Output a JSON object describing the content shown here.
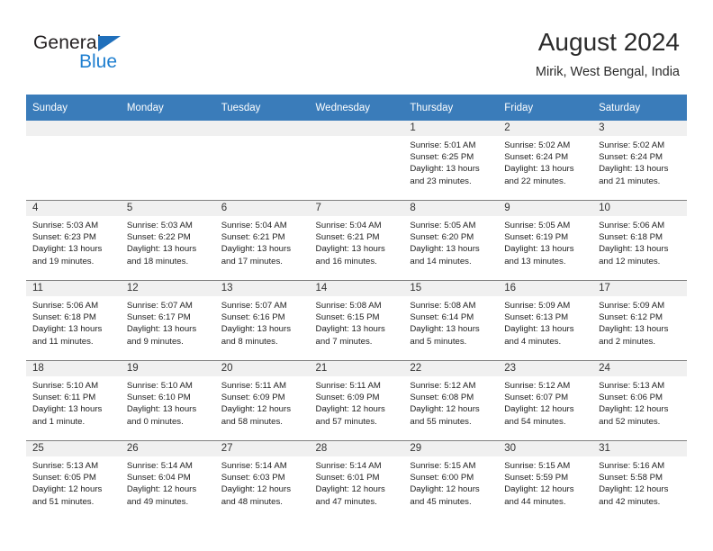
{
  "logo": {
    "word1": "General",
    "word2": "Blue",
    "triangle_color": "#1f6fbb",
    "word2_color": "#1f7fd0"
  },
  "header": {
    "title": "August 2024",
    "subtitle": "Mirik, West Bengal, India"
  },
  "theme": {
    "header_bg": "#3a7cba",
    "header_text": "#ffffff",
    "daynum_bg": "#f0f0f0",
    "cell_bg": "#ffffff",
    "row_separator": "#808080"
  },
  "weekdays": [
    "Sunday",
    "Monday",
    "Tuesday",
    "Wednesday",
    "Thursday",
    "Friday",
    "Saturday"
  ],
  "weeks": [
    [
      {
        "day": "",
        "lines": []
      },
      {
        "day": "",
        "lines": []
      },
      {
        "day": "",
        "lines": []
      },
      {
        "day": "",
        "lines": []
      },
      {
        "day": "1",
        "lines": [
          "Sunrise: 5:01 AM",
          "Sunset: 6:25 PM",
          "Daylight: 13 hours",
          "and 23 minutes."
        ]
      },
      {
        "day": "2",
        "lines": [
          "Sunrise: 5:02 AM",
          "Sunset: 6:24 PM",
          "Daylight: 13 hours",
          "and 22 minutes."
        ]
      },
      {
        "day": "3",
        "lines": [
          "Sunrise: 5:02 AM",
          "Sunset: 6:24 PM",
          "Daylight: 13 hours",
          "and 21 minutes."
        ]
      }
    ],
    [
      {
        "day": "4",
        "lines": [
          "Sunrise: 5:03 AM",
          "Sunset: 6:23 PM",
          "Daylight: 13 hours",
          "and 19 minutes."
        ]
      },
      {
        "day": "5",
        "lines": [
          "Sunrise: 5:03 AM",
          "Sunset: 6:22 PM",
          "Daylight: 13 hours",
          "and 18 minutes."
        ]
      },
      {
        "day": "6",
        "lines": [
          "Sunrise: 5:04 AM",
          "Sunset: 6:21 PM",
          "Daylight: 13 hours",
          "and 17 minutes."
        ]
      },
      {
        "day": "7",
        "lines": [
          "Sunrise: 5:04 AM",
          "Sunset: 6:21 PM",
          "Daylight: 13 hours",
          "and 16 minutes."
        ]
      },
      {
        "day": "8",
        "lines": [
          "Sunrise: 5:05 AM",
          "Sunset: 6:20 PM",
          "Daylight: 13 hours",
          "and 14 minutes."
        ]
      },
      {
        "day": "9",
        "lines": [
          "Sunrise: 5:05 AM",
          "Sunset: 6:19 PM",
          "Daylight: 13 hours",
          "and 13 minutes."
        ]
      },
      {
        "day": "10",
        "lines": [
          "Sunrise: 5:06 AM",
          "Sunset: 6:18 PM",
          "Daylight: 13 hours",
          "and 12 minutes."
        ]
      }
    ],
    [
      {
        "day": "11",
        "lines": [
          "Sunrise: 5:06 AM",
          "Sunset: 6:18 PM",
          "Daylight: 13 hours",
          "and 11 minutes."
        ]
      },
      {
        "day": "12",
        "lines": [
          "Sunrise: 5:07 AM",
          "Sunset: 6:17 PM",
          "Daylight: 13 hours",
          "and 9 minutes."
        ]
      },
      {
        "day": "13",
        "lines": [
          "Sunrise: 5:07 AM",
          "Sunset: 6:16 PM",
          "Daylight: 13 hours",
          "and 8 minutes."
        ]
      },
      {
        "day": "14",
        "lines": [
          "Sunrise: 5:08 AM",
          "Sunset: 6:15 PM",
          "Daylight: 13 hours",
          "and 7 minutes."
        ]
      },
      {
        "day": "15",
        "lines": [
          "Sunrise: 5:08 AM",
          "Sunset: 6:14 PM",
          "Daylight: 13 hours",
          "and 5 minutes."
        ]
      },
      {
        "day": "16",
        "lines": [
          "Sunrise: 5:09 AM",
          "Sunset: 6:13 PM",
          "Daylight: 13 hours",
          "and 4 minutes."
        ]
      },
      {
        "day": "17",
        "lines": [
          "Sunrise: 5:09 AM",
          "Sunset: 6:12 PM",
          "Daylight: 13 hours",
          "and 2 minutes."
        ]
      }
    ],
    [
      {
        "day": "18",
        "lines": [
          "Sunrise: 5:10 AM",
          "Sunset: 6:11 PM",
          "Daylight: 13 hours",
          "and 1 minute."
        ]
      },
      {
        "day": "19",
        "lines": [
          "Sunrise: 5:10 AM",
          "Sunset: 6:10 PM",
          "Daylight: 13 hours",
          "and 0 minutes."
        ]
      },
      {
        "day": "20",
        "lines": [
          "Sunrise: 5:11 AM",
          "Sunset: 6:09 PM",
          "Daylight: 12 hours",
          "and 58 minutes."
        ]
      },
      {
        "day": "21",
        "lines": [
          "Sunrise: 5:11 AM",
          "Sunset: 6:09 PM",
          "Daylight: 12 hours",
          "and 57 minutes."
        ]
      },
      {
        "day": "22",
        "lines": [
          "Sunrise: 5:12 AM",
          "Sunset: 6:08 PM",
          "Daylight: 12 hours",
          "and 55 minutes."
        ]
      },
      {
        "day": "23",
        "lines": [
          "Sunrise: 5:12 AM",
          "Sunset: 6:07 PM",
          "Daylight: 12 hours",
          "and 54 minutes."
        ]
      },
      {
        "day": "24",
        "lines": [
          "Sunrise: 5:13 AM",
          "Sunset: 6:06 PM",
          "Daylight: 12 hours",
          "and 52 minutes."
        ]
      }
    ],
    [
      {
        "day": "25",
        "lines": [
          "Sunrise: 5:13 AM",
          "Sunset: 6:05 PM",
          "Daylight: 12 hours",
          "and 51 minutes."
        ]
      },
      {
        "day": "26",
        "lines": [
          "Sunrise: 5:14 AM",
          "Sunset: 6:04 PM",
          "Daylight: 12 hours",
          "and 49 minutes."
        ]
      },
      {
        "day": "27",
        "lines": [
          "Sunrise: 5:14 AM",
          "Sunset: 6:03 PM",
          "Daylight: 12 hours",
          "and 48 minutes."
        ]
      },
      {
        "day": "28",
        "lines": [
          "Sunrise: 5:14 AM",
          "Sunset: 6:01 PM",
          "Daylight: 12 hours",
          "and 47 minutes."
        ]
      },
      {
        "day": "29",
        "lines": [
          "Sunrise: 5:15 AM",
          "Sunset: 6:00 PM",
          "Daylight: 12 hours",
          "and 45 minutes."
        ]
      },
      {
        "day": "30",
        "lines": [
          "Sunrise: 5:15 AM",
          "Sunset: 5:59 PM",
          "Daylight: 12 hours",
          "and 44 minutes."
        ]
      },
      {
        "day": "31",
        "lines": [
          "Sunrise: 5:16 AM",
          "Sunset: 5:58 PM",
          "Daylight: 12 hours",
          "and 42 minutes."
        ]
      }
    ]
  ]
}
